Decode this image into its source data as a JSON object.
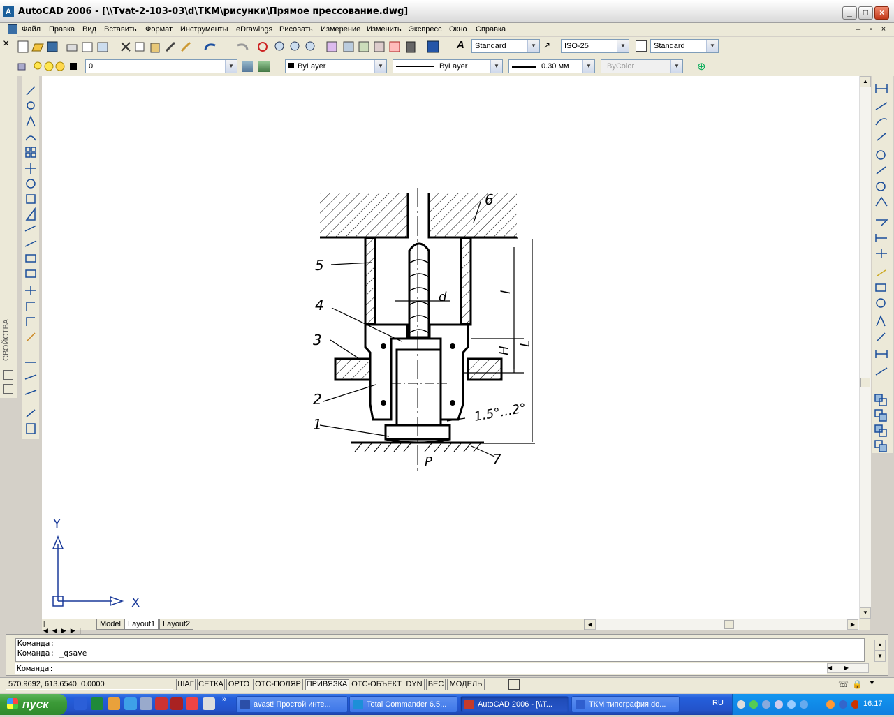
{
  "window": {
    "title": "AutoCAD 2006 - [\\\\Tvat-2-103-03\\d\\TKM\\рисунки\\Прямое прессование.dwg]",
    "controls": {
      "minimize": "_",
      "maximize": "□",
      "close": "×"
    }
  },
  "menu": {
    "items": [
      "Файл",
      "Правка",
      "Вид",
      "Вставить",
      "Формат",
      "Инструменты",
      "eDrawings",
      "Рисовать",
      "Измерение",
      "Изменить",
      "Экспресс",
      "Окно",
      "Справка"
    ],
    "doc_controls": [
      "–",
      "▫",
      "×"
    ]
  },
  "toolbars": {
    "text_style": "Standard",
    "dim_style": "ISO-25",
    "table_style": "Standard",
    "layer": "0",
    "color": "ByLayer",
    "linetype": "ByLayer",
    "lineweight": "0.30 мм",
    "plot_style": "ByColor"
  },
  "side_panel": {
    "label": "СВОЙСТВА"
  },
  "drawing": {
    "labels": {
      "n1": "1",
      "n2": "2",
      "n3": "3",
      "n4": "4",
      "n5": "5",
      "n6": "6",
      "n7": "7",
      "d": "d",
      "P": "P",
      "l": "l",
      "H": "H",
      "L": "L",
      "angle": "1.5°...2°"
    },
    "ucs": {
      "x": "X",
      "y": "Y"
    }
  },
  "tabs": [
    {
      "label": "Model",
      "active": false
    },
    {
      "label": "Layout1",
      "active": true
    },
    {
      "label": "Layout2",
      "active": false
    }
  ],
  "command": {
    "history": [
      "Команда:",
      "Команда: _qsave"
    ],
    "prompt": "Команда:"
  },
  "status": {
    "coords": "570.9692, 613.6540, 0.0000",
    "buttons": [
      {
        "label": "ШАГ",
        "on": false
      },
      {
        "label": "СЕТКА",
        "on": false
      },
      {
        "label": "ОРТО",
        "on": false
      },
      {
        "label": "ОТС-ПОЛЯР",
        "on": false
      },
      {
        "label": "ПРИВЯЗКА",
        "on": true
      },
      {
        "label": "ОТС-ОБЪЕКТ",
        "on": false
      },
      {
        "label": "DYN",
        "on": false
      },
      {
        "label": "ВЕС",
        "on": false
      },
      {
        "label": "МОДЕЛЬ",
        "on": false
      }
    ]
  },
  "taskbar": {
    "start": "пуск",
    "tasks": [
      {
        "label": "avast! Простой инте...",
        "active": false,
        "color": "#2b4fa8"
      },
      {
        "label": "Total Commander 6.5...",
        "active": false,
        "color": "#1d8fd8"
      },
      {
        "label": "AutoCAD 2006 - [\\\\T...",
        "active": true,
        "color": "#c63b2a"
      },
      {
        "label": "ТКМ типография.do...",
        "active": false,
        "color": "#2f5fcf"
      }
    ],
    "language": "RU",
    "clock": "16:17"
  }
}
